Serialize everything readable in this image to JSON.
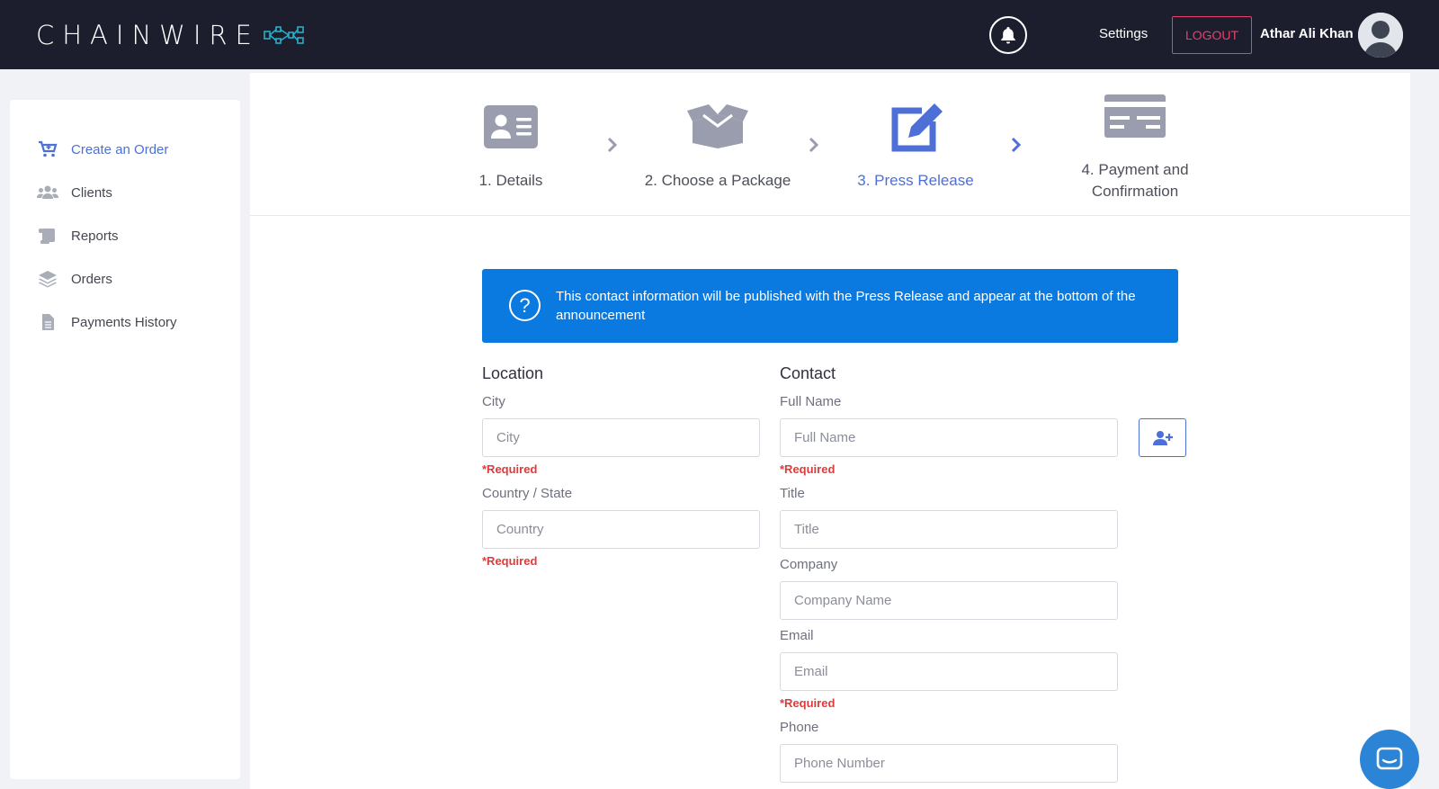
{
  "header": {
    "logo_text": "CHAINWIRE",
    "settings_label": "Settings",
    "logout_label": "LOGOUT",
    "user_name": "Athar Ali Khan"
  },
  "sidebar": {
    "items": [
      {
        "label": "Create an Order",
        "icon": "cart-plus-icon",
        "active": true
      },
      {
        "label": "Clients",
        "icon": "users-icon",
        "active": false
      },
      {
        "label": "Reports",
        "icon": "scroll-icon",
        "active": false
      },
      {
        "label": "Orders",
        "icon": "layers-icon",
        "active": false
      },
      {
        "label": "Payments History",
        "icon": "document-icon",
        "active": false
      }
    ]
  },
  "steps": [
    {
      "label": "1. Details",
      "icon": "id-card-icon",
      "active": false
    },
    {
      "label": "2. Choose a Package",
      "icon": "open-box-icon",
      "active": false
    },
    {
      "label": "3. Press Release",
      "icon": "edit-icon",
      "active": true
    },
    {
      "label_line1": "4. Payment and",
      "label_line2": "Confirmation",
      "icon": "credit-card-icon",
      "active": false
    }
  ],
  "info_banner": {
    "text": "This contact information will be published with the Press Release and appear at the bottom of the announcement"
  },
  "location": {
    "title": "Location",
    "city_label": "City",
    "city_placeholder": "City",
    "city_required": "*Required",
    "country_label": "Country / State",
    "country_placeholder": "Country",
    "country_required": "*Required"
  },
  "contact": {
    "title": "Contact",
    "fullname_label": "Full Name",
    "fullname_placeholder": "Full Name",
    "fullname_required": "*Required",
    "title_label": "Title",
    "title_placeholder": "Title",
    "company_label": "Company",
    "company_placeholder": "Company Name",
    "email_label": "Email",
    "email_placeholder": "Email",
    "email_required": "*Required",
    "phone_label": "Phone",
    "phone_placeholder": "Phone Number"
  },
  "colors": {
    "topbar": "#1c1e2e",
    "accent": "#4e6fd8",
    "banner": "#0a7ae0",
    "required": "#e03a3a",
    "logout": "#e8406a"
  }
}
